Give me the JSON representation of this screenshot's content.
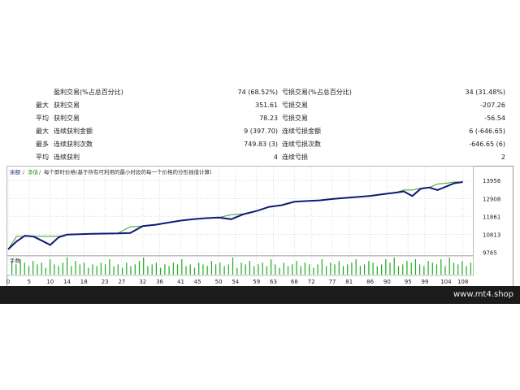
{
  "stats": [
    {
      "c1": "",
      "c2": "盈利交易(%占总百分比)",
      "c3": "74 (68.52%)",
      "c4": "亏损交易(%占总百分比)",
      "c5": "34 (31.48%)"
    },
    {
      "c1": "最大",
      "c2": "获利交易",
      "c3": "351.61",
      "c4": "亏损交易",
      "c5": "-207.26"
    },
    {
      "c1": "平均",
      "c2": "获利交易",
      "c3": "78.23",
      "c4": "亏损交易",
      "c5": "-56.54"
    },
    {
      "c1": "最大",
      "c2": "连续获利金额",
      "c3": "9 (397.70)",
      "c4": "连续亏损金额",
      "c5": "6 (-646.65)"
    },
    {
      "c1": "最多",
      "c2": "连续获利次数",
      "c3": "749.83 (3)",
      "c4": "连续亏损次数",
      "c5": "-646.65 (6)"
    },
    {
      "c1": "平均",
      "c2": "连续获利",
      "c3": "4",
      "c4": "连续亏损",
      "c5": "2"
    }
  ],
  "chart_header": {
    "balance_label": "余额",
    "equity_label": "净值",
    "note": "每个即时价格(基于所有可利用的最小时段的每一个价格的分形插值计算)"
  },
  "volume_label": "手数",
  "colors": {
    "balance": "#0d1a7a",
    "equity": "#3a9d23",
    "volume": "#22aa22",
    "grid": "#d9d9d9"
  },
  "chart_data": {
    "type": "line",
    "x_ticks": [
      0,
      5,
      10,
      14,
      18,
      23,
      27,
      32,
      36,
      41,
      45,
      50,
      54,
      59,
      63,
      68,
      72,
      77,
      81,
      86,
      90,
      95,
      99,
      104,
      108
    ],
    "y_ticks": [
      9765,
      10813,
      11861,
      12908,
      13956
    ],
    "ylim": [
      9700,
      14250
    ],
    "xlim": [
      0,
      110
    ],
    "series": [
      {
        "name": "余额",
        "x": [
          0,
          2,
          4,
          6,
          8,
          10,
          12,
          14,
          17,
          20,
          23,
          26,
          29,
          32,
          35,
          38,
          41,
          44,
          47,
          50,
          53,
          56,
          59,
          62,
          65,
          68,
          71,
          74,
          77,
          80,
          83,
          86,
          89,
          92,
          94,
          96,
          98,
          100,
          102,
          104,
          106,
          108
        ],
        "y": [
          9940,
          10400,
          10740,
          10690,
          10450,
          10200,
          10650,
          10800,
          10830,
          10850,
          10860,
          10870,
          10900,
          11300,
          11380,
          11500,
          11620,
          11700,
          11760,
          11800,
          11700,
          12000,
          12180,
          12420,
          12520,
          12720,
          12760,
          12800,
          12880,
          12940,
          13000,
          13060,
          13160,
          13250,
          13320,
          13050,
          13480,
          13550,
          13400,
          13600,
          13800,
          13870
        ]
      },
      {
        "name": "净值",
        "x": [
          0,
          2,
          4,
          6,
          8,
          10,
          12,
          14,
          17,
          20,
          23,
          26,
          29,
          32,
          35,
          38,
          41,
          44,
          47,
          50,
          53,
          56,
          59,
          62,
          65,
          68,
          71,
          74,
          77,
          80,
          83,
          86,
          89,
          92,
          94,
          96,
          98,
          100,
          102,
          104,
          106,
          108
        ],
        "y": [
          9940,
          10700,
          10700,
          10700,
          10700,
          10700,
          10700,
          10800,
          10830,
          10850,
          10860,
          10870,
          11260,
          11300,
          11380,
          11500,
          11620,
          11700,
          11760,
          11800,
          11960,
          12020,
          12180,
          12420,
          12520,
          12720,
          12780,
          12800,
          12880,
          12940,
          13010,
          13060,
          13170,
          13250,
          13400,
          13400,
          13500,
          13550,
          13750,
          13800,
          13870,
          13870
        ]
      }
    ],
    "volume": [
      0.8,
      0.6,
      0.9,
      0.7,
      0.5,
      0.8,
      0.6,
      0.7,
      0.4,
      0.9,
      0.6,
      0.5,
      0.7,
      1.0,
      0.5,
      0.8,
      0.6,
      0.7,
      0.4,
      0.6,
      0.5,
      0.7,
      0.6,
      0.9,
      0.5,
      0.6,
      0.4,
      0.7,
      0.5,
      0.6,
      0.8,
      1.0,
      0.5,
      0.6,
      0.7,
      0.4,
      0.6,
      0.5,
      0.7,
      0.6,
      0.9,
      0.5,
      0.6,
      0.4,
      0.7,
      0.6,
      0.5,
      0.8,
      0.6,
      0.7,
      0.5,
      0.6,
      1.0,
      0.4,
      0.7,
      0.6,
      0.8,
      0.5,
      0.6,
      0.7,
      0.5,
      0.9,
      0.6,
      0.4,
      0.7,
      0.5,
      0.6,
      0.8,
      0.5,
      0.7,
      0.6,
      0.4,
      0.6,
      0.9,
      0.5,
      0.7,
      0.6,
      0.8,
      0.5,
      0.6,
      0.7,
      0.9,
      0.5,
      0.6,
      0.8,
      0.7,
      0.5,
      0.6,
      0.9,
      0.7,
      1.0,
      0.5,
      0.6,
      0.8,
      0.7,
      0.9,
      0.6,
      0.5,
      0.8,
      0.7,
      0.6,
      0.9,
      0.5,
      1.0,
      0.7,
      0.6,
      0.8,
      0.5,
      0.7
    ],
    "grid": true,
    "legend": "top-left"
  },
  "footer": {
    "brand": "www.mt4.shop"
  }
}
